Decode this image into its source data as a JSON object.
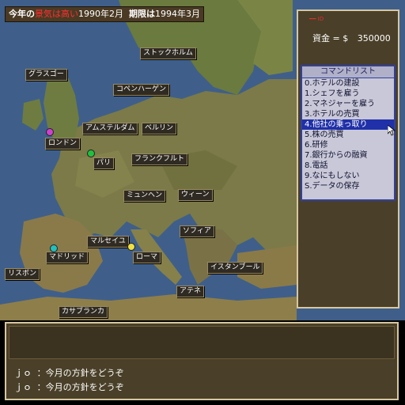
{
  "header": {
    "prefix": "今年の",
    "highlight": "景気は高い",
    "date": "1990年2月",
    "deadline_label": "期限は",
    "deadline": "1994年3月"
  },
  "side": {
    "tag": "━━ ID",
    "funds_label": "資金 = $",
    "funds_value": "350000"
  },
  "commands": {
    "title": "コマンドリスト",
    "items": [
      "0.ホテルの建設",
      "1.シェフを雇う",
      "2.マネジャーを雇う",
      "3.ホテルの売買",
      "4.他社の乗っ取り",
      "5.株の売買",
      "6.研修",
      "7.銀行からの融資",
      "8.電話",
      "9.なにもしない",
      "S.データの保存"
    ],
    "selected_index": 4
  },
  "cities": [
    "ストックホルム",
    "グラスゴー",
    "コペンハーゲン",
    "アムステルダム",
    "ベルリン",
    "ロンドン",
    "パリ",
    "フランクフルト",
    "ミュンヘン",
    "ウィーン",
    "マルセイユ",
    "マドリッド",
    "ローマ",
    "ソフィア",
    "イスタンブール",
    "リスボン",
    "アテネ",
    "カサブランカ"
  ],
  "messages": [
    "ｊｏ  ：今月の方針をどうぞ",
    "ｊｏ  ：今月の方針をどうぞ"
  ],
  "pins": {
    "london_color": "#d040d0",
    "paris_color": "#20c040",
    "madrid_color": "#20c0c0",
    "rome_color": "#f0e040"
  }
}
